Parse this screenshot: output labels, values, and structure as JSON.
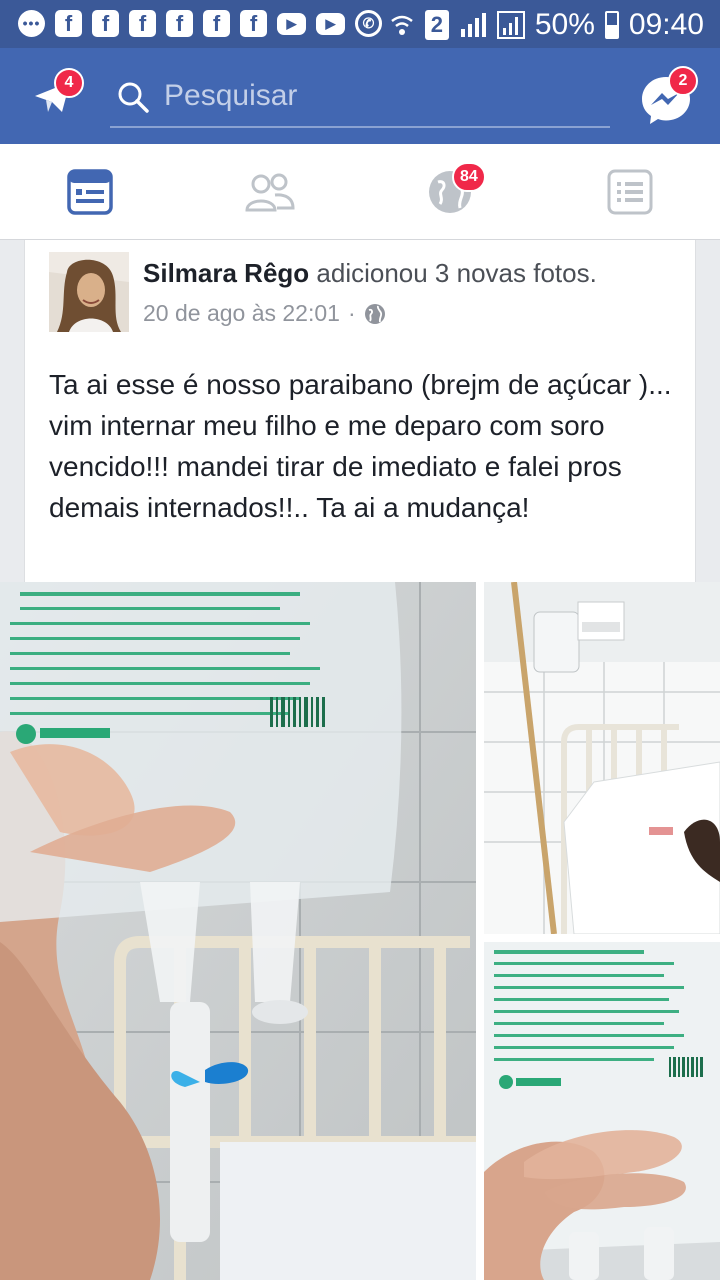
{
  "status_bar": {
    "battery": "50%",
    "time": "09:40",
    "sim": "2",
    "icons": [
      "chat-bubble-icon",
      "facebook-icon",
      "facebook-icon",
      "facebook-icon",
      "facebook-icon",
      "facebook-icon",
      "facebook-icon",
      "youtube-icon",
      "youtube-icon",
      "whatsapp-icon"
    ]
  },
  "header": {
    "search_placeholder": "Pesquisar",
    "notifications_badge": "4",
    "messenger_badge": "2",
    "colors": {
      "bar": "#4267b2",
      "badge": "#f02849"
    }
  },
  "tabs": [
    {
      "name": "news-feed",
      "icon": "news-feed-icon",
      "active": true
    },
    {
      "name": "friends",
      "icon": "friends-icon",
      "active": false
    },
    {
      "name": "notifications",
      "icon": "globe-icon",
      "badge": "84",
      "active": false
    },
    {
      "name": "menu",
      "icon": "menu-list-icon",
      "active": false
    }
  ],
  "post": {
    "author": "Silmara Rêgo",
    "action": " adicionou 3 novas fotos.",
    "date": "20 de ago às 22:01",
    "separator": "·",
    "privacy_icon": "globe-icon",
    "text": "Ta ai esse é nosso paraibano (brejm de açúcar )... vim internar meu filho e me deparo com soro vencido!!! mandei tirar de imediato e falei pros demais internados!!.. Ta ai a mudança!",
    "photos": [
      "saline-bag-photo",
      "hospital-bed-photo",
      "saline-bag-closeup-photo"
    ]
  }
}
